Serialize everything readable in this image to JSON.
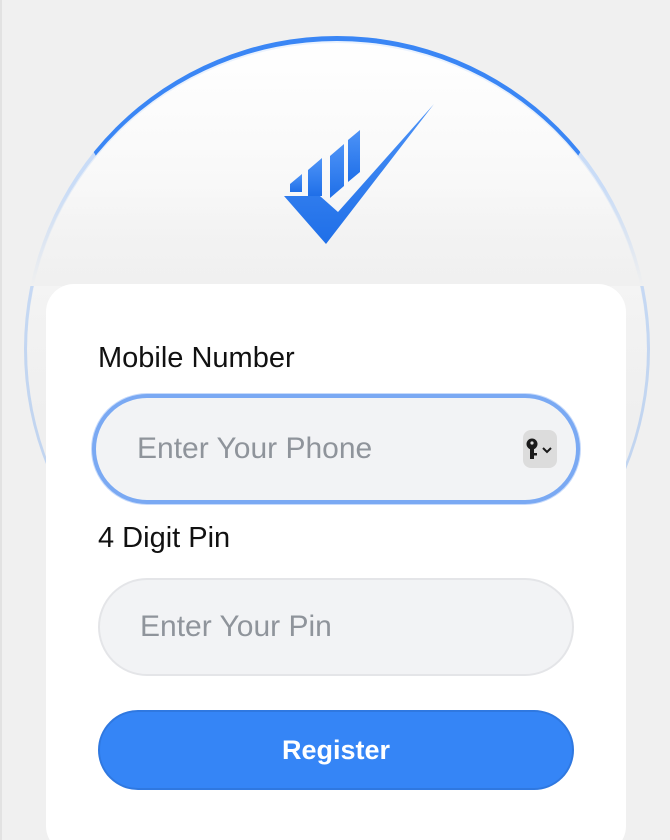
{
  "colors": {
    "accent": "#3585f6",
    "background": "#f0f0f0",
    "card": "#ffffff",
    "focus_ring": "#7aa9f3"
  },
  "logo": {
    "icon": "check-logo-icon"
  },
  "form": {
    "mobile": {
      "label": "Mobile Number",
      "placeholder": "Enter Your Phone",
      "value": "",
      "autofill_icon": "key-autofill-icon"
    },
    "pin": {
      "label": "4 Digit Pin",
      "placeholder": "Enter Your Pin",
      "value": ""
    },
    "submit_label": "Register"
  }
}
